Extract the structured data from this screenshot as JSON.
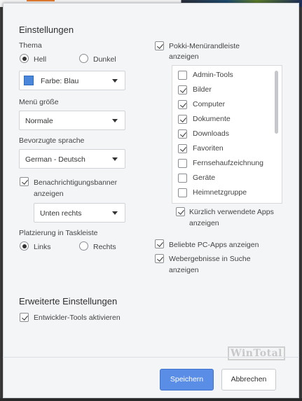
{
  "settings_title": "Einstellungen",
  "theme": {
    "label": "Thema",
    "options": [
      "Hell",
      "Dunkel"
    ],
    "selected": "Hell",
    "color_select": "Farbe: Blau",
    "color_swatch": "#4a86d9"
  },
  "menu_size": {
    "label": "Menü größe",
    "value": "Normale"
  },
  "language": {
    "label": "Bevorzugte sprache",
    "value": "German - Deutsch"
  },
  "notifications": {
    "checkbox_label_1": "Benachrichtigungsbanner",
    "checkbox_label_2": "anzeigen",
    "checked": true,
    "position_value": "Unten rechts"
  },
  "taskbar": {
    "label": "Platzierung in Taskleiste",
    "options": [
      "Links",
      "Rechts"
    ],
    "selected": "Links"
  },
  "pokki_sidebar": {
    "label_1": "Pokki-Menürandleiste",
    "label_2": "anzeigen",
    "checked": true,
    "items": [
      {
        "label": "Admin-Tools",
        "checked": false
      },
      {
        "label": "Bilder",
        "checked": true
      },
      {
        "label": "Computer",
        "checked": true
      },
      {
        "label": "Dokumente",
        "checked": true
      },
      {
        "label": "Downloads",
        "checked": true
      },
      {
        "label": "Favoriten",
        "checked": true
      },
      {
        "label": "Fernsehaufzeichnung",
        "checked": false
      },
      {
        "label": "Geräte",
        "checked": false
      },
      {
        "label": "Heimnetzgruppe",
        "checked": false
      }
    ],
    "recent_apps_1": "Kürzlich verwendete Apps",
    "recent_apps_2": "anzeigen",
    "recent_apps_checked": true
  },
  "popular_apps": {
    "label": "Beliebte PC-Apps anzeigen",
    "checked": true
  },
  "web_results": {
    "label_1": "Webergebnisse in Suche",
    "label_2": "anzeigen",
    "checked": true
  },
  "advanced": {
    "title": "Erweiterte Einstellungen",
    "dev_tools_label": "Entwickler-Tools aktivieren",
    "dev_tools_checked": true
  },
  "watermark": "WinTotal",
  "buttons": {
    "save": "Speichern",
    "cancel": "Abbrechen"
  },
  "colors": {
    "accent": "#5a8ee6",
    "dialog_bg": "#f4f5f7"
  }
}
